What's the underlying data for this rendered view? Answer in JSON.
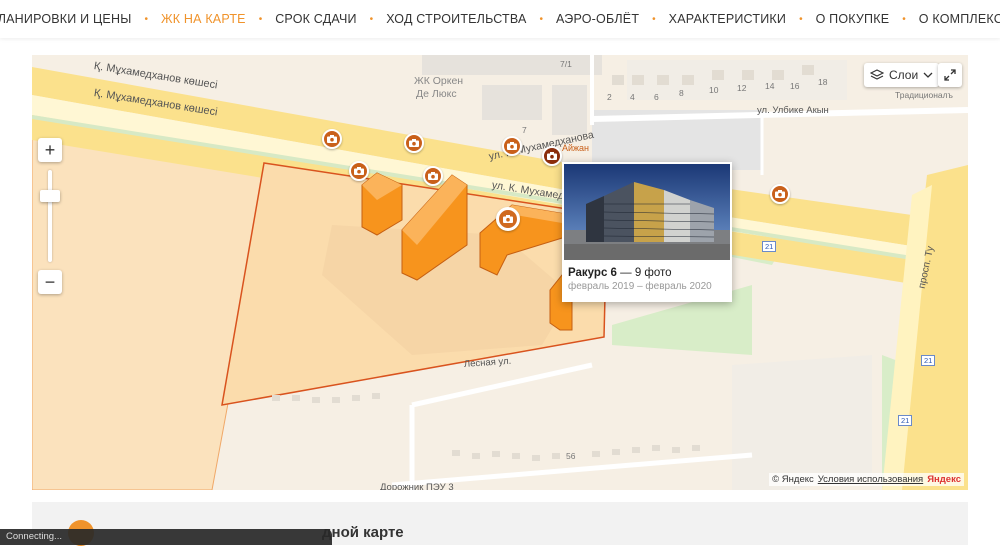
{
  "nav": {
    "items": [
      "ПЛАНИРОВКИ И ЦЕНЫ",
      "ЖК НА КАРТЕ",
      "СРОК СДАЧИ",
      "ХОД СТРОИТЕЛЬСТВА",
      "АЭРО-ОБЛЁТ",
      "ХАРАКТЕРИСТИКИ",
      "О ПОКУПКЕ",
      "О КОМПЛЕКСЕ"
    ],
    "active": "ЖК НА КАРТЕ",
    "accent": "#f0932b"
  },
  "map": {
    "streets": {
      "main1": "Қ. Мұхамедханов көшесі",
      "main2": "Қ. Мұхамедханов көшесі",
      "ru1": "ул. К. Мухамедханова",
      "ru2": "ул. К. Мухамедханова",
      "ulbike": "ул. Улбике Акын",
      "lesnaya": "Лесная ул.",
      "prosp": "просп. Ту",
      "dorozhnik": "Дорожник ПЭУ 3"
    },
    "places": {
      "orken_1": "ЖК Оркен",
      "orken_2": "Де Люкс",
      "aizhan": "Айжан",
      "traditional": "Традиционалъ"
    },
    "house_numbers": [
      "7/1",
      "7",
      "2",
      "4",
      "6",
      "8",
      "10",
      "12",
      "14",
      "16",
      "18",
      "56"
    ],
    "badges": [
      "21",
      "21",
      "21"
    ],
    "colors": {
      "complex_fill": "#fbdcac",
      "building": "#f7941d",
      "camera": "#c9601a",
      "road": "#fbe18c"
    },
    "icons": [
      "camera-icon",
      "layers-icon",
      "fullscreen-icon",
      "zoom-in-icon",
      "zoom-out-icon",
      "chevron-down-icon"
    ]
  },
  "controls": {
    "zoom_in": "+",
    "zoom_out": "−",
    "layers_label": "Слои"
  },
  "popup": {
    "title": "Ракурс 6",
    "count": "— 9 фото",
    "dates": "февраль 2019 – февраль 2020"
  },
  "attribution": {
    "copyright": "© Яндекс",
    "terms": "Условия использования",
    "logo": "Яндекс"
  },
  "section": {
    "heading": "дной карте"
  },
  "status": {
    "text": "Connecting..."
  }
}
